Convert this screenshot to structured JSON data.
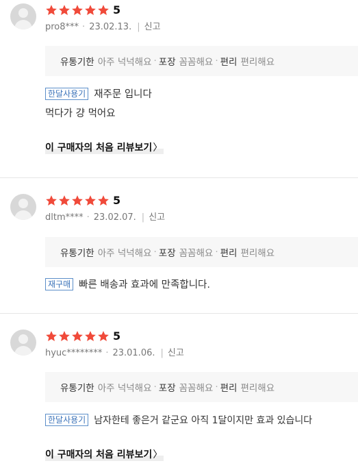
{
  "reviews": [
    {
      "score": "5",
      "user": "pro8***",
      "date": "23.02.13.",
      "report": "신고",
      "options": [
        {
          "key": "유통기한",
          "value": "아주 넉넉해요"
        },
        {
          "key": "포장",
          "value": "꼼꼼해요"
        },
        {
          "key": "편리",
          "value": "편리해요"
        }
      ],
      "badge": "한달사용기",
      "text1": "재주문 입니다",
      "text2": "먹다가 걍 먹어요",
      "more": "이 구매자의 처음 리뷰보기"
    },
    {
      "score": "5",
      "user": "dltm****",
      "date": "23.02.07.",
      "report": "신고",
      "options": [
        {
          "key": "유통기한",
          "value": "아주 넉넉해요"
        },
        {
          "key": "포장",
          "value": "꼼꼼해요"
        },
        {
          "key": "편리",
          "value": "편리해요"
        }
      ],
      "badge": "재구매",
      "text1": "빠른 배송과 효과에 만족합니다."
    },
    {
      "score": "5",
      "user": "hyuc********",
      "date": "23.01.06.",
      "report": "신고",
      "options": [
        {
          "key": "유통기한",
          "value": "아주 넉넉해요"
        },
        {
          "key": "포장",
          "value": "꼼꼼해요"
        },
        {
          "key": "편리",
          "value": "편리해요"
        }
      ],
      "badge": "한달사용기",
      "text1": "남자한테 좋은거 같군요 아직 1달이지만 효과 있습니다",
      "more": "이 구매자의 처음 리뷰보기"
    }
  ],
  "ui": {
    "star_color": "#f04a3a",
    "badge_color": "#3b73b9",
    "chevron": "〉",
    "dot": "·",
    "bar": "|"
  }
}
